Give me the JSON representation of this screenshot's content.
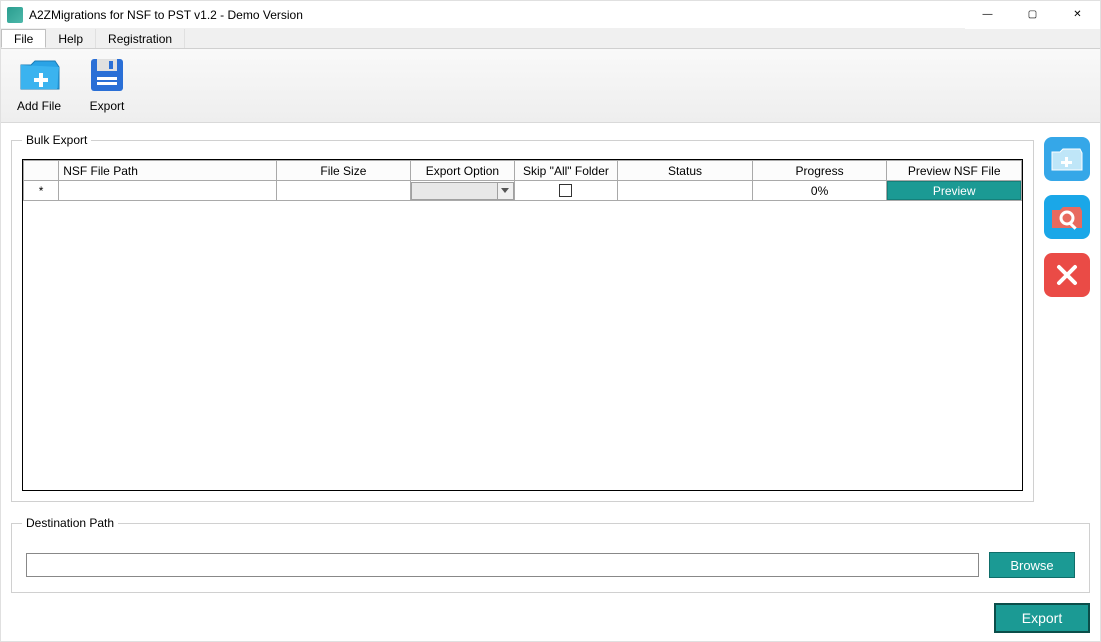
{
  "window": {
    "title": "A2ZMigrations for NSF to PST v1.2 - Demo Version"
  },
  "menu": {
    "items": [
      "File",
      "Help",
      "Registration"
    ],
    "active_index": 0
  },
  "toolbar": {
    "add_file": "Add File",
    "export": "Export"
  },
  "bulk_export": {
    "legend": "Bulk Export",
    "columns": [
      "",
      "NSF File Path",
      "File Size",
      "Export Option",
      "Skip \"All\" Folder",
      "Status",
      "Progress",
      "Preview NSF File"
    ],
    "rows": [
      {
        "marker": "*",
        "nsf_file_path": "",
        "file_size": "",
        "export_option": "",
        "skip_all_folder": false,
        "status": "",
        "progress": "0%",
        "preview_label": "Preview"
      }
    ]
  },
  "side": {
    "add_icon": "folder-plus-icon",
    "search_icon": "folder-search-icon",
    "remove_icon": "close-icon"
  },
  "destination": {
    "legend": "Destination Path",
    "value": "",
    "browse_label": "Browse"
  },
  "footer": {
    "export_label": "Export"
  },
  "window_controls": {
    "minimize": "—",
    "maximize": "▢",
    "close": "✕"
  }
}
